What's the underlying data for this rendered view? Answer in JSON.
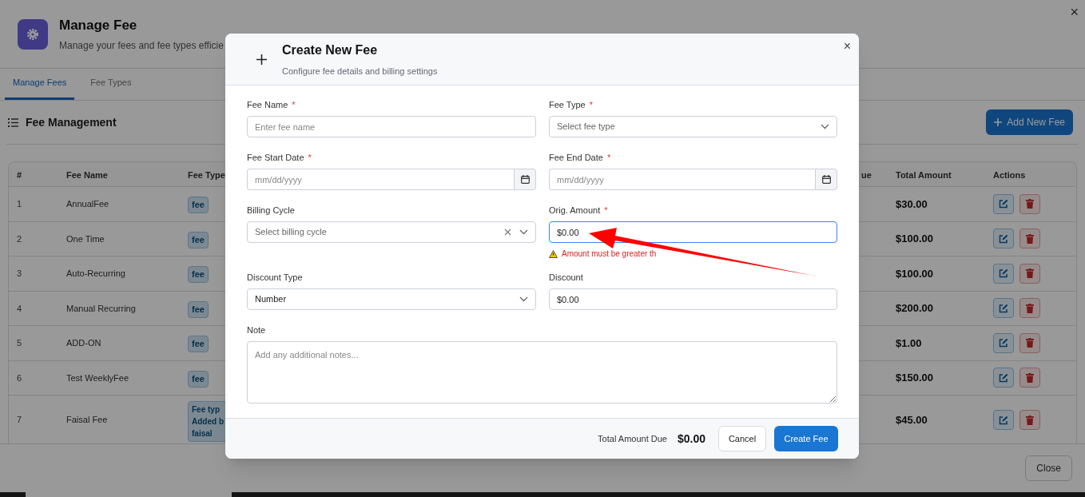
{
  "page": {
    "title": "Manage Fee",
    "subtitle": "Manage your fees and fee types efficie",
    "close_label": "×"
  },
  "tabs": [
    {
      "label": "Manage Fees",
      "selected": true
    },
    {
      "label": "Fee Types",
      "selected": false
    }
  ],
  "section": {
    "title": "Fee Management",
    "add_button": "Add New Fee"
  },
  "table": {
    "columns": [
      "#",
      "Fee Name",
      "Fee Type",
      "ue",
      "Total Amount",
      "Actions"
    ],
    "rows": [
      {
        "number": "1",
        "fee_name": "AnnualFee",
        "fee_type": [
          "fee"
        ],
        "total": "$30.00"
      },
      {
        "number": "2",
        "fee_name": "One Time",
        "fee_type": [
          "fee"
        ],
        "total": "$100.00"
      },
      {
        "number": "3",
        "fee_name": "Auto-Recurring",
        "fee_type": [
          "fee"
        ],
        "total": "$100.00"
      },
      {
        "number": "4",
        "fee_name": "Manual Recurring",
        "fee_type": [
          "fee"
        ],
        "total": "$200.00"
      },
      {
        "number": "5",
        "fee_name": "ADD-ON",
        "fee_type": [
          "fee"
        ],
        "total": "$1.00"
      },
      {
        "number": "6",
        "fee_name": "Test WeeklyFee",
        "fee_type": [
          "fee"
        ],
        "total": "$150.00"
      },
      {
        "number": "7",
        "fee_name": "Faisal Fee",
        "fee_type": [
          "Fee typ",
          "Added b",
          "faisal"
        ],
        "total": "$45.00"
      }
    ]
  },
  "footer": {
    "close_button": "Close"
  },
  "dialog": {
    "title": "Create New Fee",
    "subtitle": "Configure fee details and billing settings",
    "close_label": "×",
    "fields": [
      {
        "kind": "text",
        "label": "Fee Name",
        "required_mark": "*",
        "placeholder": "Enter fee name"
      },
      {
        "kind": "select",
        "label": "Fee Type",
        "required_mark": "*",
        "placeholder": "Select fee type"
      },
      {
        "kind": "date",
        "label": "Fee Start Date",
        "required_mark": "*",
        "placeholder": "mm/dd/yyyy"
      },
      {
        "kind": "date",
        "label": "Fee End Date",
        "required_mark": "*",
        "placeholder": "mm/dd/yyyy"
      },
      {
        "kind": "select",
        "label": "Billing Cycle",
        "placeholder": "Select billing cycle",
        "clearable": true
      },
      {
        "kind": "text",
        "label": "Orig. Amount",
        "required_mark": "*",
        "value": "$0.00",
        "focused": true,
        "error": "Amount must be greater th"
      },
      {
        "kind": "select",
        "label": "Discount Type",
        "value": "Number"
      },
      {
        "kind": "text",
        "label": "Discount",
        "value": "$0.00"
      },
      {
        "kind": "textarea",
        "label": "Note",
        "placeholder": "Add any additional notes..."
      }
    ],
    "total_label": "Total Amount Due",
    "total_value": "$0.00",
    "cancel_button": "Cancel",
    "submit_button": "Create Fee"
  }
}
